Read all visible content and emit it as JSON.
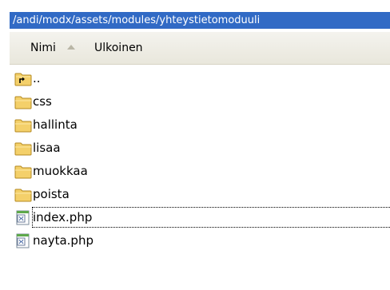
{
  "path": "/andi/modx/assets/modules/yhteystietomoduuli",
  "columns": {
    "name": "Nimi",
    "external": "Ulkoinen"
  },
  "items": [
    {
      "label": "..",
      "type": "parent",
      "icon": "folder-up-icon"
    },
    {
      "label": "css",
      "type": "folder",
      "icon": "folder-icon"
    },
    {
      "label": "hallinta",
      "type": "folder",
      "icon": "folder-icon"
    },
    {
      "label": "lisaa",
      "type": "folder",
      "icon": "folder-icon"
    },
    {
      "label": "muokkaa",
      "type": "folder",
      "icon": "folder-icon"
    },
    {
      "label": "poista",
      "type": "folder",
      "icon": "folder-icon"
    },
    {
      "label": "index.php",
      "type": "file",
      "icon": "php-file-icon",
      "focused": true
    },
    {
      "label": "nayta.php",
      "type": "file",
      "icon": "php-file-icon"
    }
  ],
  "colors": {
    "path_bar": "#316ac5",
    "folder": "#f4d06a"
  }
}
